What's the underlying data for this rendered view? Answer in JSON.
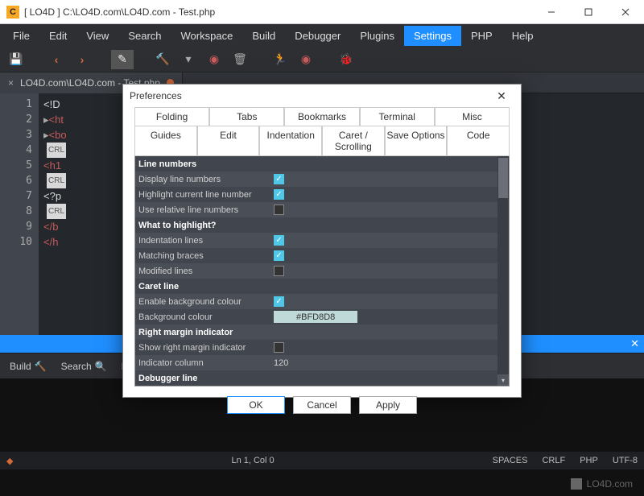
{
  "window": {
    "app_initial": "C",
    "title": "[ LO4D ] C:\\LO4D.com\\LO4D.com - Test.php",
    "min": "—",
    "max": "□",
    "close": "✕"
  },
  "menu": {
    "items": [
      "File",
      "Edit",
      "View",
      "Search",
      "Workspace",
      "Build",
      "Debugger",
      "Plugins",
      "Settings",
      "PHP",
      "Help"
    ],
    "active": "Settings"
  },
  "tab": {
    "label": "LO4D.com\\LO4D.com - Test.php",
    "close": "×"
  },
  "editor": {
    "lines": [
      "1",
      "2",
      "3",
      "4",
      "5",
      "6",
      "7",
      "8",
      "9",
      "10"
    ],
    "rows": [
      {
        "t": "wi",
        "text": "<!D"
      },
      {
        "t": "r",
        "text": "<ht"
      },
      {
        "t": "r",
        "text": "<bo"
      },
      {
        "t": "crlf",
        "text": "CRL"
      },
      {
        "t": "r",
        "text": "<h1"
      },
      {
        "t": "crlf",
        "text": "CRL"
      },
      {
        "t": "wi",
        "text": "<?p"
      },
      {
        "t": "crlf",
        "text": "CRL"
      },
      {
        "t": "r",
        "text": "</b"
      },
      {
        "t": "r",
        "text": "</h"
      }
    ]
  },
  "findbar": {
    "close": "✕"
  },
  "bottom": {
    "build": "Build",
    "search": "Search",
    "replace": "Repla"
  },
  "status": {
    "pos": "Ln 1, Col 0",
    "spaces": "SPACES",
    "crlf": "CRLF",
    "lang": "PHP",
    "enc": "UTF-8"
  },
  "watermark": {
    "text": "LO4D.com"
  },
  "dialog": {
    "title": "Preferences",
    "close": "✕",
    "tabs_top": [
      "Folding",
      "Tabs",
      "Bookmarks",
      "Terminal",
      "Misc"
    ],
    "tabs_bot": [
      "Guides",
      "Edit",
      "Indentation",
      "Caret / Scrolling",
      "Save Options",
      "Code"
    ],
    "active_tab": "Guides",
    "sections": {
      "s1": "Line numbers",
      "s1a": "Display line numbers",
      "s1b": "Highlight current line number",
      "s1c": "Use relative line numbers",
      "s2": "What to highlight?",
      "s2a": "Indentation lines",
      "s2b": "Matching braces",
      "s2c": "Modified lines",
      "s3": "Caret line",
      "s3a": "Enable background colour",
      "s3b": "Background colour",
      "s3b_val": "#BFD8D8",
      "s4": "Right margin indicator",
      "s4a": "Show right margin indicator",
      "s4b": "Indicator column",
      "s4b_val": "120",
      "s5": "Debugger line"
    },
    "buttons": {
      "ok": "OK",
      "cancel": "Cancel",
      "apply": "Apply"
    }
  }
}
